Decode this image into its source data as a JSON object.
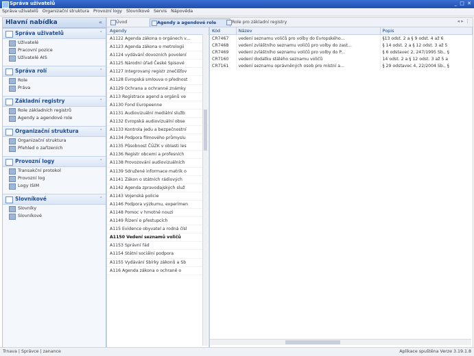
{
  "window": {
    "title": "Správa uživatelů",
    "buttons": "_ □ ✕"
  },
  "menu": [
    "Správa uživatelů",
    "Organizační struktura",
    "Provozní logy",
    "Slovníkové",
    "Servis",
    "Nápověda"
  ],
  "nav": {
    "title": "Hlavní nabídka",
    "sections": [
      {
        "label": "Správa uživatelů",
        "items": [
          "Uživatelé",
          "Pracovní pozice",
          "Uživatelé AIS"
        ]
      },
      {
        "label": "Správa rolí",
        "items": [
          "Role",
          "Práva"
        ]
      },
      {
        "label": "Základní registry",
        "items": [
          "Role základních registrů",
          "Agendy a agendové role"
        ]
      },
      {
        "label": "Organizační struktura",
        "items": [
          "Organizační struktura",
          "Přehled o zařízeních"
        ]
      },
      {
        "label": "Provozní logy",
        "items": [
          "Transakční protokol",
          "Provozní log",
          "Logy ISIM"
        ]
      },
      {
        "label": "Slovníkové",
        "items": [
          "Slovníky",
          "Slovníkové"
        ]
      }
    ]
  },
  "tabs": [
    {
      "label": "Úvod",
      "active": false
    },
    {
      "label": "Agendy a agendové role",
      "active": true
    },
    {
      "label": "Role pro základní registry",
      "active": false
    }
  ],
  "pager": "◂ ▸ ⋮",
  "agendy": {
    "header": "Agendy",
    "rows": [
      {
        "text": "A1122 Agenda zákona o orgánech v...",
        "bold": false
      },
      {
        "text": "A1123 Agenda zákona o metrologii",
        "bold": false
      },
      {
        "text": "A1124 vydávání dovozních povolení",
        "bold": false
      },
      {
        "text": "A1125 Národní úřad České Spisové",
        "bold": false
      },
      {
        "text": "A1127 Integrovaný registr znečišťov",
        "bold": false
      },
      {
        "text": "A1128 Evropská smlouva o přednost",
        "bold": false
      },
      {
        "text": "A1129 Ochrana a ochranné známky",
        "bold": false
      },
      {
        "text": "A113 Registrace agend a orgánů ve",
        "bold": false
      },
      {
        "text": "A1130 Fond Europeenne",
        "bold": false
      },
      {
        "text": "A1131 Audiovizuální mediální služb",
        "bold": false
      },
      {
        "text": "A1132 Evropská audiovizuální obse",
        "bold": false
      },
      {
        "text": "A1133 Kontrola jedu a bezpečnostní",
        "bold": false
      },
      {
        "text": "A1134 Podpora filmového průmyslu",
        "bold": false
      },
      {
        "text": "A1135 Působnost ČÚZK v oblasti les",
        "bold": false
      },
      {
        "text": "A1136 Registr obcemi a profesních",
        "bold": false
      },
      {
        "text": "A1138 Provozování audiovizuálních",
        "bold": false
      },
      {
        "text": "A1139 Sdružené informace matrik o",
        "bold": false
      },
      {
        "text": "A1141 Zákon o státních rádiových",
        "bold": false
      },
      {
        "text": "A1142 Agenda zpravodajských služ",
        "bold": false
      },
      {
        "text": "A1143 Vojenská policie",
        "bold": false
      },
      {
        "text": "A1146 Podpora výzkumu, experimen",
        "bold": false
      },
      {
        "text": "A1148 Pomoc v hmotné nouzi",
        "bold": false
      },
      {
        "text": "A1149 Řízení o přestupcích",
        "bold": false
      },
      {
        "text": "A115 Evidence obyvatel a rodná čísl",
        "bold": false
      },
      {
        "text": "A1150 Vedení seznamů voličů",
        "bold": true
      },
      {
        "text": "A1153 Správní řád",
        "bold": false
      },
      {
        "text": "A1154 Státní sociální podpora",
        "bold": false
      },
      {
        "text": "A1155 Vydávání Sbírky zákonů a Sb",
        "bold": false
      },
      {
        "text": "A116 Agenda zákona o ochraně o",
        "bold": false
      }
    ]
  },
  "grid": {
    "columns": [
      "Kód",
      "Název",
      "Popis"
    ],
    "rows": [
      [
        "CR7467",
        "vedení seznamu voličů pro volby do Evropského...",
        "§13 odst. 2 a § 9 odst. 4 až 6"
      ],
      [
        "CR7468",
        "vedení zvláštního seznamu voličů pro volby do zast...",
        "§ 14 odst. 2 a § 12 odst. 3 až 5"
      ],
      [
        "CR7469",
        "vedení zvláštního seznamu voličů pro volby do P...",
        "§ 6 odstavec 2, 247/1995 Sb., §"
      ],
      [
        "CR7160",
        "vedení dodatku stálého seznamu voličů",
        "14 odst. 2 a § 12 odst. 3 až 5 a"
      ],
      [
        "CR7161",
        "vedení seznamu oprávněných osob pro místní a...",
        "§ 29 odstavec 4, 22/2004 Sb., §"
      ]
    ]
  },
  "status": {
    "left": "Trnava | Správce | zanance",
    "right": "Aplikace spuštěna   Verze 3.19.1.8"
  }
}
